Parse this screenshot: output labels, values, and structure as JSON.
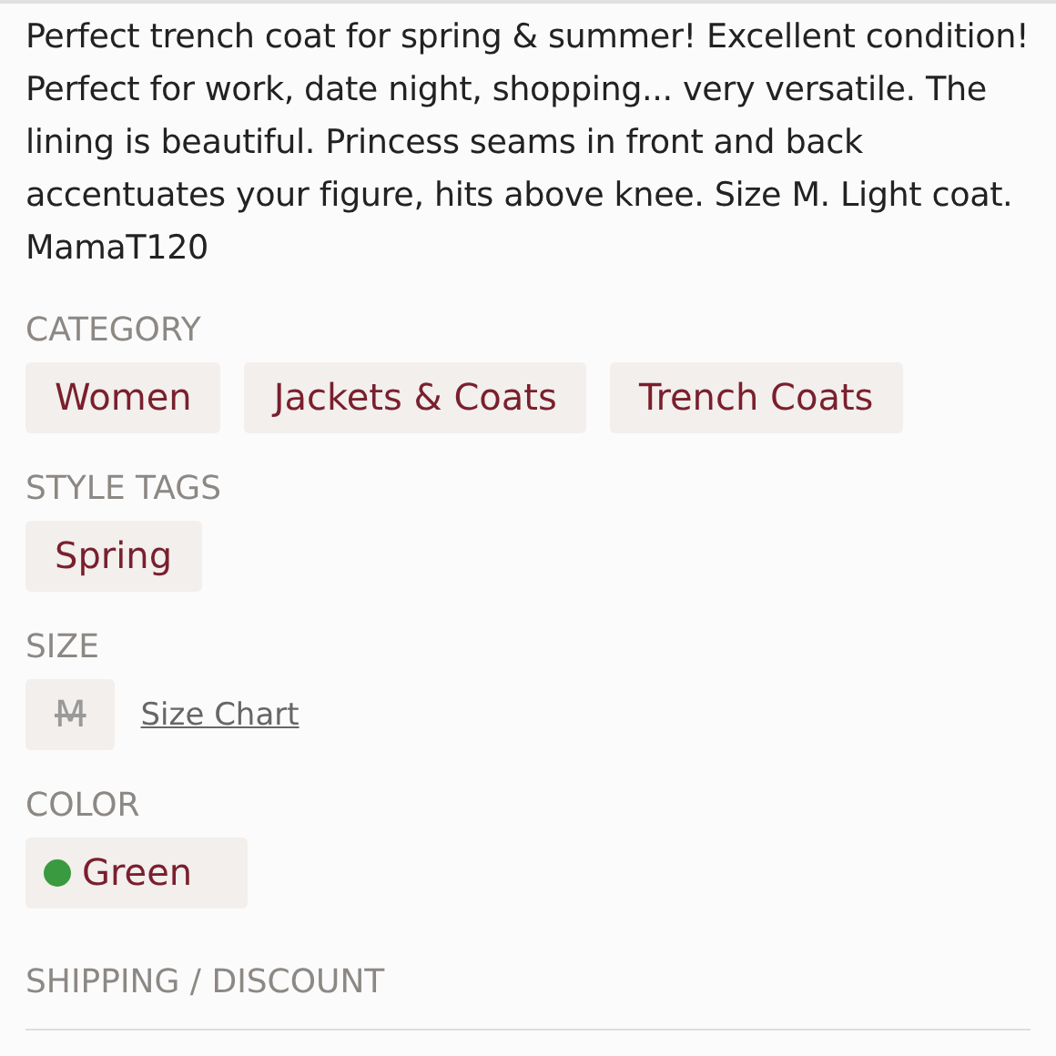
{
  "description": "Perfect trench coat for spring & summer! Excellent condition! Perfect for work, date night, shopping... very versatile. The lining is beautiful. Princess seams in front and back accentuates your figure, hits above knee. Size M. Light coat. MamaT120",
  "category": {
    "heading": "CATEGORY",
    "chips": [
      "Women",
      "Jackets & Coats",
      "Trench Coats"
    ]
  },
  "style_tags": {
    "heading": "STYLE TAGS",
    "chips": [
      "Spring"
    ]
  },
  "size": {
    "heading": "SIZE",
    "value": "M",
    "available": false,
    "link": "Size Chart"
  },
  "color": {
    "heading": "COLOR",
    "name": "Green",
    "color": "#3a9a3f"
  },
  "shipping": {
    "heading": "SHIPPING / DISCOUNT"
  }
}
